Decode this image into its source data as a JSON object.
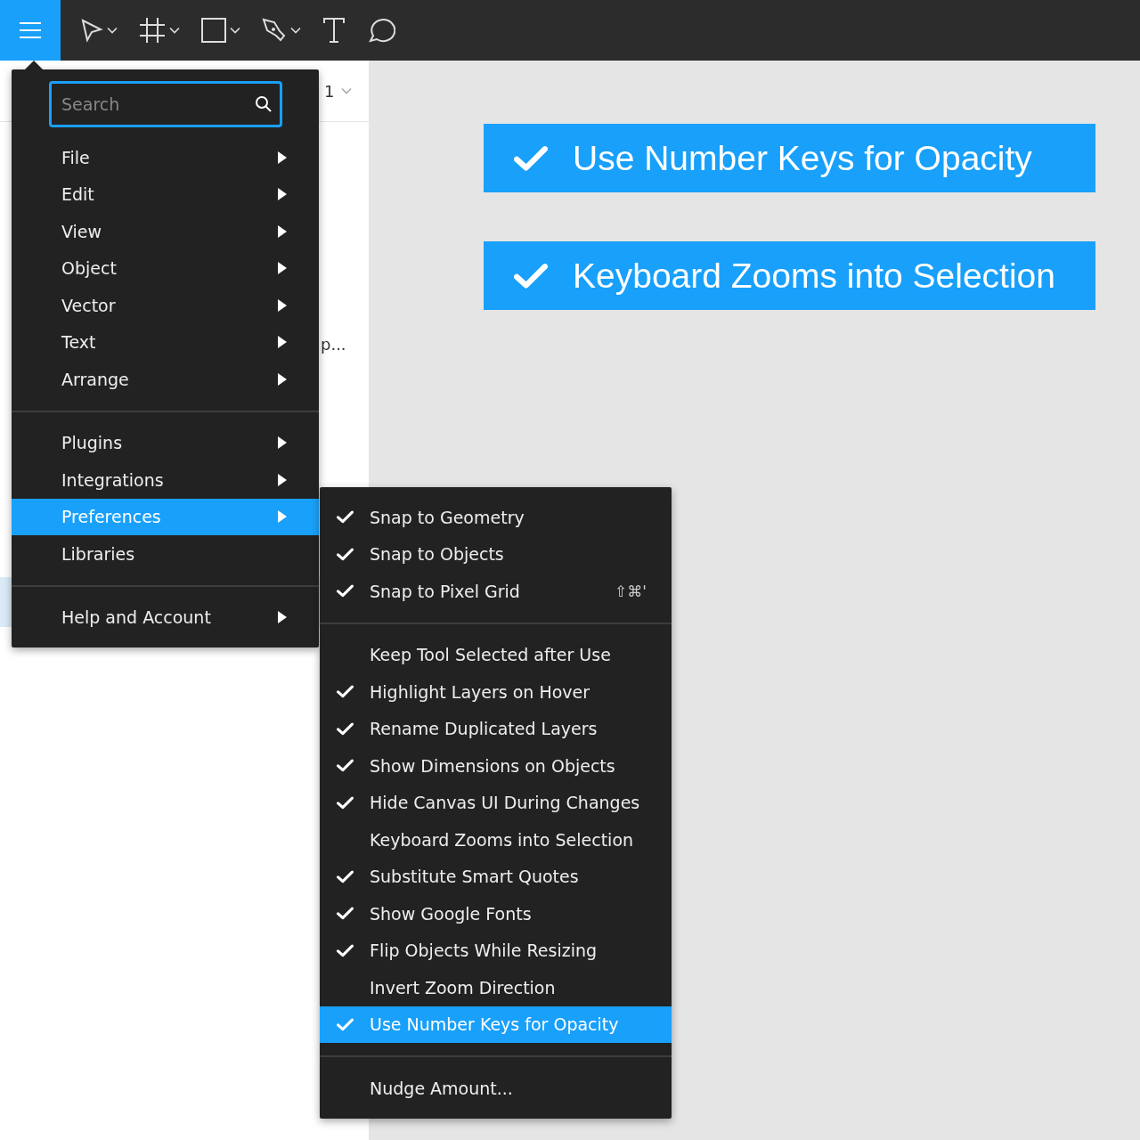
{
  "toolbar": {
    "menu_button": {
      "selected": true
    },
    "tools": [
      {
        "kind": "move",
        "dropdown": true
      },
      {
        "kind": "frame",
        "dropdown": true
      },
      {
        "kind": "shape",
        "dropdown": true
      },
      {
        "kind": "pen",
        "dropdown": true
      },
      {
        "kind": "text",
        "dropdown": false
      },
      {
        "kind": "comment",
        "dropdown": false
      }
    ]
  },
  "layers_panel": {
    "page_label": "1",
    "layer_label": "p...",
    "rows": [
      {
        "selected": true
      }
    ]
  },
  "callouts": [
    {
      "label": "Use Number Keys for Opacity",
      "checked": true
    },
    {
      "label": "Keyboard Zooms into Selection",
      "checked": true
    }
  ],
  "main_menu": {
    "search": {
      "placeholder": "Search"
    },
    "groups": [
      [
        {
          "label": "File",
          "submenu": true,
          "selected": false
        },
        {
          "label": "Edit",
          "submenu": true,
          "selected": false
        },
        {
          "label": "View",
          "submenu": true,
          "selected": false
        },
        {
          "label": "Object",
          "submenu": true,
          "selected": false
        },
        {
          "label": "Vector",
          "submenu": true,
          "selected": false
        },
        {
          "label": "Text",
          "submenu": true,
          "selected": false
        },
        {
          "label": "Arrange",
          "submenu": true,
          "selected": false
        }
      ],
      [
        {
          "label": "Plugins",
          "submenu": true,
          "selected": false
        },
        {
          "label": "Integrations",
          "submenu": true,
          "selected": false
        },
        {
          "label": "Preferences",
          "submenu": true,
          "selected": true
        },
        {
          "label": "Libraries",
          "submenu": false,
          "selected": false
        }
      ],
      [
        {
          "label": "Help and Account",
          "submenu": true,
          "selected": false
        }
      ]
    ]
  },
  "preferences_menu": {
    "groups": [
      [
        {
          "label": "Snap to Geometry",
          "checked": true,
          "selected": false
        },
        {
          "label": "Snap to Objects",
          "checked": true,
          "selected": false
        },
        {
          "label": "Snap to Pixel Grid",
          "checked": true,
          "selected": false,
          "shortcut": "⇧⌘'"
        }
      ],
      [
        {
          "label": "Keep Tool Selected after Use",
          "checked": false,
          "selected": false
        },
        {
          "label": "Highlight Layers on Hover",
          "checked": true,
          "selected": false
        },
        {
          "label": "Rename Duplicated Layers",
          "checked": true,
          "selected": false
        },
        {
          "label": "Show Dimensions on Objects",
          "checked": true,
          "selected": false
        },
        {
          "label": "Hide Canvas UI During Changes",
          "checked": true,
          "selected": false
        },
        {
          "label": "Keyboard Zooms into Selection",
          "checked": false,
          "selected": false
        },
        {
          "label": "Substitute Smart Quotes",
          "checked": true,
          "selected": false
        },
        {
          "label": "Show Google Fonts",
          "checked": true,
          "selected": false
        },
        {
          "label": "Flip Objects While Resizing",
          "checked": true,
          "selected": false
        },
        {
          "label": "Invert Zoom Direction",
          "checked": false,
          "selected": false
        },
        {
          "label": "Use Number Keys for Opacity",
          "checked": true,
          "selected": true
        }
      ],
      [
        {
          "label": "Nudge Amount...",
          "checked": false,
          "selected": false
        }
      ]
    ]
  }
}
